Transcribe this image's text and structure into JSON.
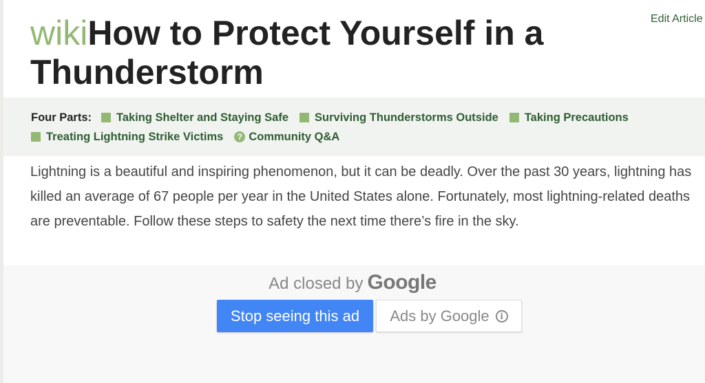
{
  "header": {
    "edit_link": "Edit Article",
    "brand_prefix": "wiki",
    "title": "How to Protect Yourself in a Thunderstorm"
  },
  "toc": {
    "lead": "Four Parts:",
    "parts": [
      {
        "label": "Taking Shelter and Staying Safe",
        "icon": "green-square-icon"
      },
      {
        "label": "Surviving Thunderstorms Outside",
        "icon": "green-square-icon"
      },
      {
        "label": "Taking Precautions",
        "icon": "green-square-icon"
      },
      {
        "label": "Treating Lightning Strike Victims",
        "icon": "green-square-icon"
      }
    ],
    "qa": {
      "label": "Community Q&A",
      "icon": "question-circle-icon",
      "glyph": "?"
    }
  },
  "intro": "Lightning is a beautiful and inspiring phenomenon, but it can be deadly. Over the past 30 years, lightning has killed an average of 67 people per year in the United States alone. Fortunately, most lightning-related deaths are preventable. Follow these steps to safety the next time there’s fire in the sky.",
  "ad": {
    "closed_text": "Ad closed by",
    "google_logo": "Google",
    "stop_button": "Stop seeing this ad",
    "ads_by_button": "Ads by Google",
    "info_icon": "i"
  },
  "colors": {
    "brand_green": "#93b874",
    "link_green": "#2f5d33",
    "ad_blue": "#4285f4"
  }
}
